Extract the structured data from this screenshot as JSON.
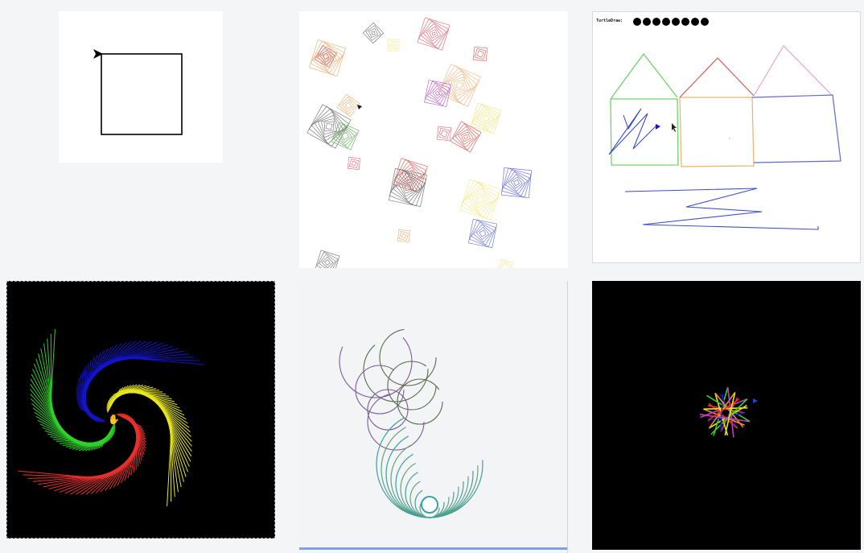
{
  "tiles": [
    {
      "id": "square-turtle",
      "background": "#ffffff"
    },
    {
      "id": "spiral-squares-scatter",
      "background": "#ffffff"
    },
    {
      "id": "turtledraw-app",
      "background": "#ffffff",
      "label": "TurtleDraw:",
      "dot_count": 8
    },
    {
      "id": "rgb-spiral",
      "background": "#000000"
    },
    {
      "id": "circle-loops",
      "background": "#f3f4f5"
    },
    {
      "id": "color-star",
      "background": "#000000"
    }
  ],
  "colors": {
    "red": "#e8302e",
    "green": "#2fd12a",
    "blue": "#1414c8",
    "yellow": "#e6e61e",
    "pencil_blue": "#3b4fc8",
    "house_green": "#6fd46a",
    "house_red": "#d95a5a",
    "house_pink": "#e7a3d2",
    "house_orange": "#e8b36b"
  }
}
